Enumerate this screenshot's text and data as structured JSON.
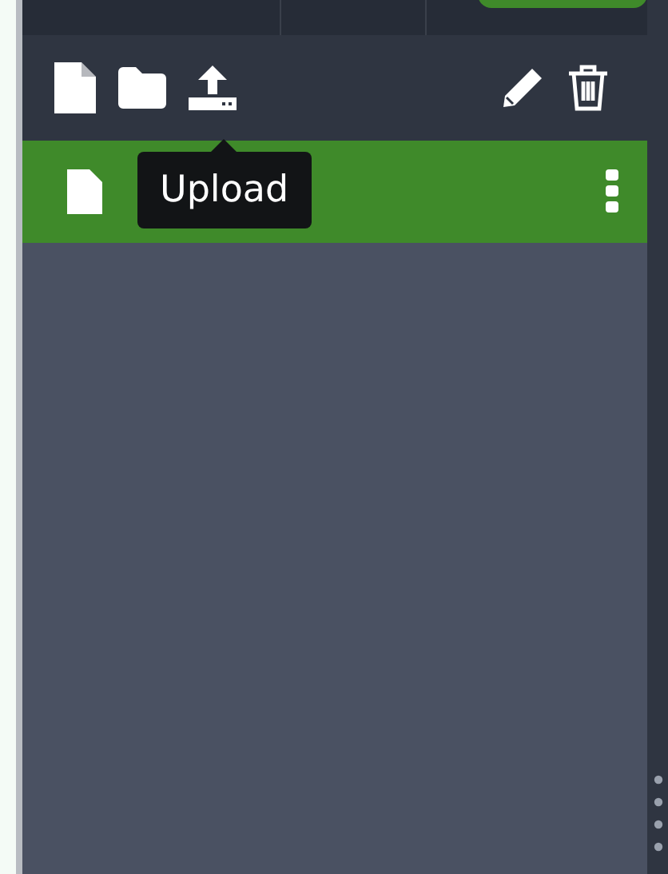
{
  "toolbar": {
    "tooltip": "Upload"
  },
  "files": [
    {
      "selected": true
    }
  ]
}
